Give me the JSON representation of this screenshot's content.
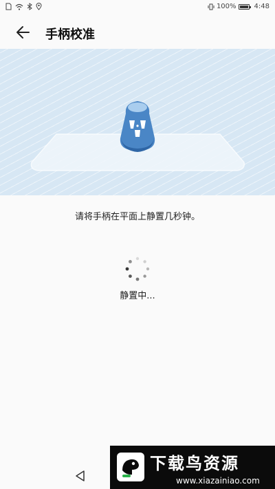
{
  "status_bar": {
    "battery_percent": "100%",
    "time": "4:48",
    "icons": [
      "sim-icon",
      "wifi-icon",
      "bluetooth-icon",
      "location-icon",
      "vibrate-icon",
      "battery-icon"
    ]
  },
  "app_bar": {
    "title": "手柄校准",
    "back_icon": "arrow-left-icon"
  },
  "banner": {
    "illustration": "gamepad-on-platform"
  },
  "instruction": "请将手柄在平面上静置几秒钟。",
  "calibration": {
    "status": "静置中..."
  },
  "nav_bar": {
    "back_icon": "triangle-back-icon"
  },
  "watermark": {
    "title": "下载鸟资源",
    "url": "www.xiazainiao.com"
  },
  "colors": {
    "banner_bg": "#d7e7f4",
    "gamepad": "#4a86c6",
    "page_bg": "#fafafa"
  }
}
